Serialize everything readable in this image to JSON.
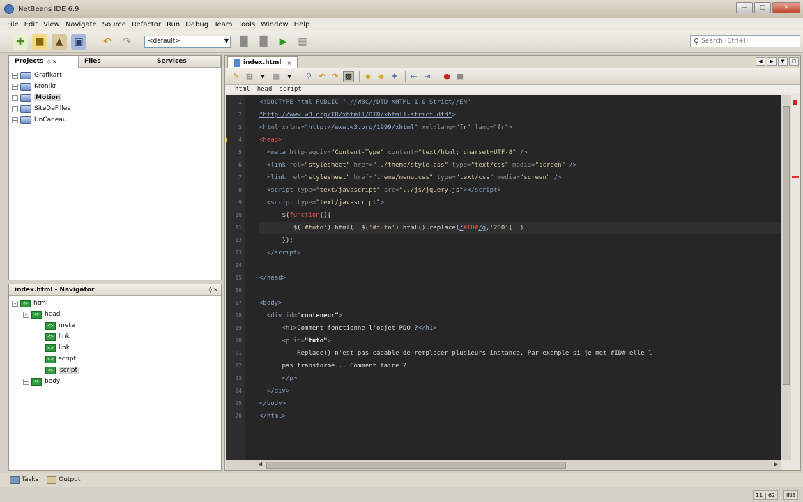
{
  "window": {
    "title": "NetBeans IDE 6.9"
  },
  "menu": [
    "File",
    "Edit",
    "View",
    "Navigate",
    "Source",
    "Refactor",
    "Run",
    "Debug",
    "Team",
    "Tools",
    "Window",
    "Help"
  ],
  "toolbar": {
    "config": "<default>",
    "search_placeholder": "Search (Ctrl+I)"
  },
  "projects_panel": {
    "tabs": [
      "Projects",
      "Files",
      "Services"
    ],
    "items": [
      "Grafikart",
      "Kronikr",
      "Motion",
      "SiteDeFilles",
      "UnCadeau"
    ]
  },
  "navigator": {
    "title": "index.html - Navigator",
    "items": [
      {
        "label": "html",
        "depth": 0
      },
      {
        "label": "head",
        "depth": 1
      },
      {
        "label": "meta",
        "depth": 2
      },
      {
        "label": "link",
        "depth": 2
      },
      {
        "label": "link",
        "depth": 2
      },
      {
        "label": "script",
        "depth": 2
      },
      {
        "label": "script",
        "depth": 2
      },
      {
        "label": "body",
        "depth": 1
      }
    ]
  },
  "editor": {
    "tab": "index.html",
    "breadcrumb": [
      "html",
      "head",
      "script"
    ]
  },
  "bottom": {
    "tasks": "Tasks",
    "output": "Output"
  },
  "status": {
    "position": "11 | 62",
    "mode": "INS"
  }
}
